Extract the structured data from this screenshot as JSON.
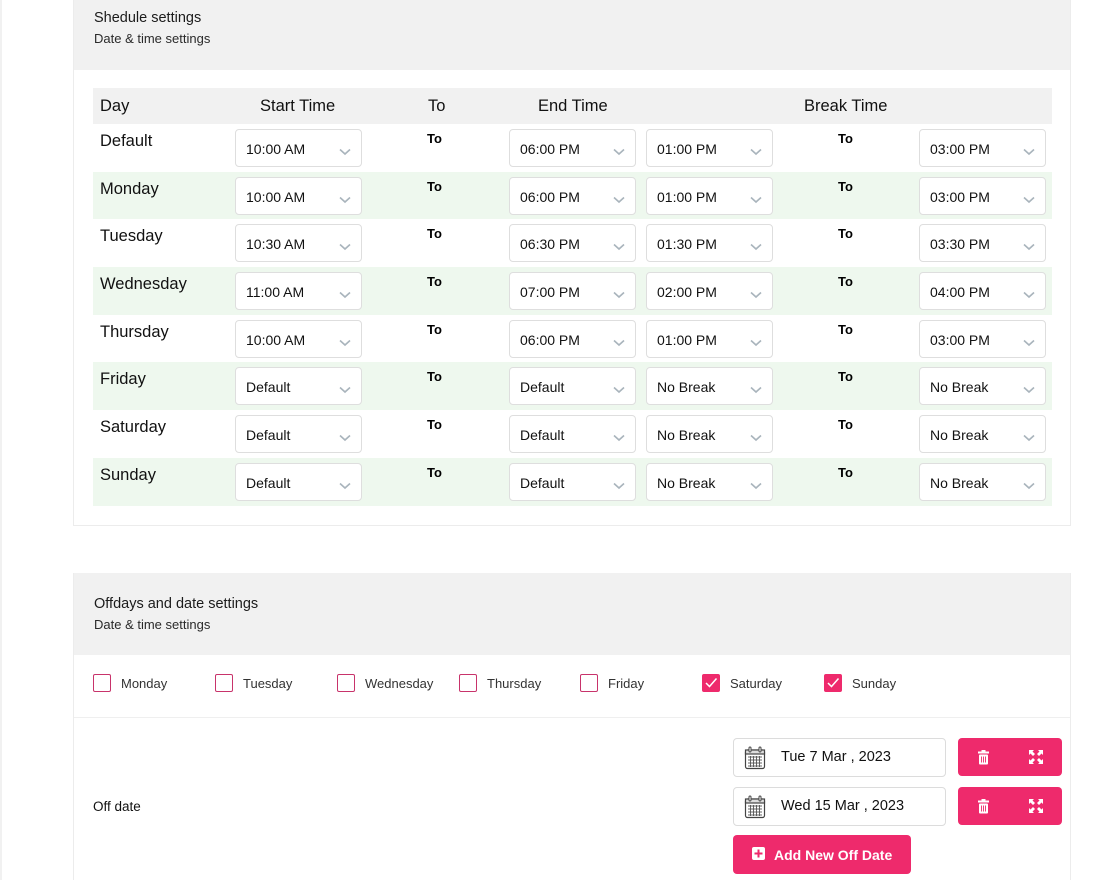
{
  "schedule": {
    "title": "Shedule settings",
    "subtitle": "Date & time settings",
    "headers": {
      "day": "Day",
      "start": "Start Time",
      "to": "To",
      "end": "End Time",
      "break": "Break Time"
    },
    "to_label": "To",
    "rows": [
      {
        "day": "Default",
        "start": "10:00 AM",
        "end": "06:00 PM",
        "break_start": "01:00 PM",
        "break_end": "03:00 PM"
      },
      {
        "day": "Monday",
        "start": "10:00 AM",
        "end": "06:00 PM",
        "break_start": "01:00 PM",
        "break_end": "03:00 PM"
      },
      {
        "day": "Tuesday",
        "start": "10:30 AM",
        "end": "06:30 PM",
        "break_start": "01:30 PM",
        "break_end": "03:30 PM"
      },
      {
        "day": "Wednesday",
        "start": "11:00 AM",
        "end": "07:00 PM",
        "break_start": "02:00 PM",
        "break_end": "04:00 PM"
      },
      {
        "day": "Thursday",
        "start": "10:00 AM",
        "end": "06:00 PM",
        "break_start": "01:00 PM",
        "break_end": "03:00 PM"
      },
      {
        "day": "Friday",
        "start": "Default",
        "end": "Default",
        "break_start": "No Break",
        "break_end": "No Break"
      },
      {
        "day": "Saturday",
        "start": "Default",
        "end": "Default",
        "break_start": "No Break",
        "break_end": "No Break"
      },
      {
        "day": "Sunday",
        "start": "Default",
        "end": "Default",
        "break_start": "No Break",
        "break_end": "No Break"
      }
    ]
  },
  "offdays": {
    "title": "Offdays and date settings",
    "subtitle": "Date & time settings",
    "weekdays": [
      {
        "label": "Monday",
        "checked": false
      },
      {
        "label": "Tuesday",
        "checked": false
      },
      {
        "label": "Wednesday",
        "checked": false
      },
      {
        "label": "Thursday",
        "checked": false
      },
      {
        "label": "Friday",
        "checked": false
      },
      {
        "label": "Saturday",
        "checked": true
      },
      {
        "label": "Sunday",
        "checked": true
      }
    ],
    "off_date_label": "Off date",
    "dates": [
      {
        "value": "Tue 7 Mar , 2023",
        "icon": "calendar-icon"
      },
      {
        "value": "Wed 15 Mar , 2023",
        "icon": "calendar-icon"
      }
    ],
    "row_actions": [
      "trash-icon",
      "expand-icon"
    ],
    "add_button_label": "Add New Off Date",
    "add_button_icon": "plus-square-icon"
  },
  "colors": {
    "accent": "#ee2a6c",
    "row_alt_bg": "#eef8ee",
    "header_bg": "#f1f1f1"
  }
}
